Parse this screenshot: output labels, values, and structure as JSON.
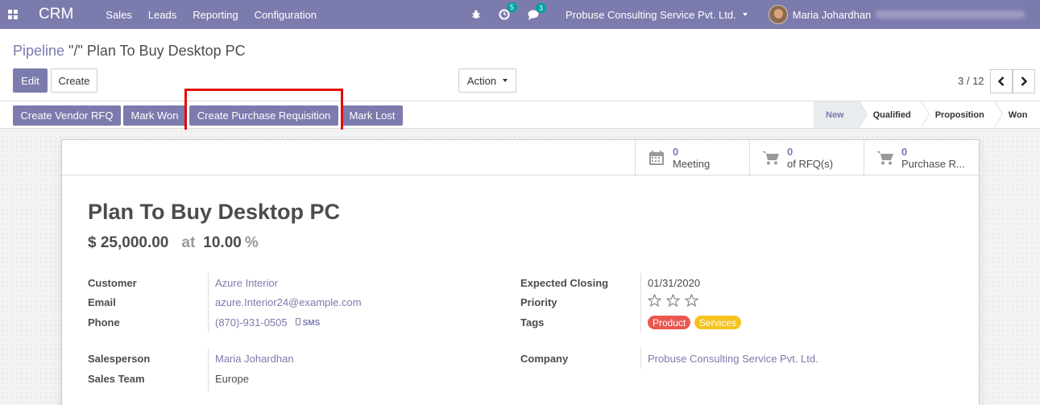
{
  "navbar": {
    "brand": "CRM",
    "menu": [
      "Sales",
      "Leads",
      "Reporting",
      "Configuration"
    ],
    "activity_count": "5",
    "message_count": "3",
    "company": "Probuse Consulting Service Pvt. Ltd.",
    "user": "Maria Johardhan"
  },
  "breadcrumb": {
    "parent": "Pipeline",
    "separator": " \"/\" ",
    "current": "Plan To Buy Desktop PC"
  },
  "toolbar": {
    "edit_label": "Edit",
    "create_label": "Create",
    "action_label": "Action",
    "pager_value": "3 / 12"
  },
  "statusbar": {
    "buttons": [
      "Create Vendor RFQ",
      "Mark Won",
      "Create Purchase Requisition",
      "Mark Lost"
    ],
    "stages": [
      "New",
      "Qualified",
      "Proposition",
      "Won"
    ],
    "active_stage": "New"
  },
  "smart_buttons": [
    {
      "count": "0",
      "label": "Meeting",
      "icon": "calendar-icon"
    },
    {
      "count": "0",
      "label": "of RFQ(s)",
      "icon": "cart-icon"
    },
    {
      "count": "0",
      "label": "Purchase R...",
      "icon": "cart-icon"
    }
  ],
  "record": {
    "title": "Plan To Buy Desktop PC",
    "revenue": "$ 25,000.00",
    "at": "at",
    "probability": "10.00",
    "percent_sign": "%"
  },
  "fields": {
    "customer_label": "Customer",
    "customer": "Azure Interior",
    "email_label": "Email",
    "email": "azure.Interior24@example.com",
    "phone_label": "Phone",
    "phone": "(870)-931-0505",
    "sms_label": "SMS",
    "salesperson_label": "Salesperson",
    "salesperson": "Maria Johardhan",
    "sales_team_label": "Sales Team",
    "sales_team": "Europe",
    "expected_closing_label": "Expected Closing",
    "expected_closing": "01/31/2020",
    "priority_label": "Priority",
    "priority_stars": 0,
    "priority_max": 3,
    "tags_label": "Tags",
    "tags": [
      {
        "name": "Product",
        "color": "#e9584f"
      },
      {
        "name": "Services",
        "color": "#f5c31d"
      }
    ],
    "company_label": "Company",
    "company": "Probuse Consulting Service Pvt. Ltd."
  },
  "colors": {
    "brand": "#7c7bad",
    "highlight": "#e20b0b"
  }
}
